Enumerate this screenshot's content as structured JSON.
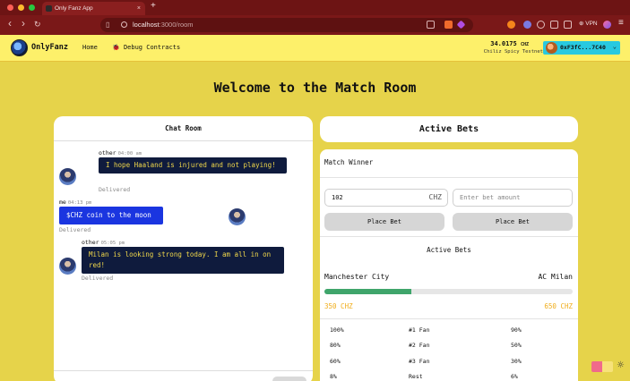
{
  "browser": {
    "tab_title": "Only Fanz App",
    "tab_close": "×",
    "new_tab": "+",
    "url_host": "localhost",
    "url_path": ":3000/room",
    "vpn_label": "VPN",
    "nav": {
      "back": "‹",
      "forward": "›",
      "reload": "↻"
    },
    "icons": [
      "bookmark-icon",
      "lock-icon",
      "share-icon",
      "brave-shield-icon",
      "extensions-icon",
      "menu-icon"
    ]
  },
  "app": {
    "brand": "OnlyFanz",
    "nav_links": {
      "home": "Home",
      "debug": "Debug Contracts"
    },
    "debug_icon": "🐞",
    "balance_value": "34.0175",
    "balance_unit": "CHZ",
    "network": "Chiliz Spicy Testnet",
    "wallet_address": "0xF3fC...7C40",
    "wallet_chevron": "⌄",
    "accent": "#28c9e0"
  },
  "page": {
    "title": "Welcome to the Match Room"
  },
  "chat": {
    "title": "Chat Room",
    "messages": [
      {
        "sender": "other",
        "time": "04:00 am",
        "text": "I hope Haaland is injured and not playing!",
        "status": "Delivered"
      },
      {
        "sender": "me",
        "time": "04:13 pm",
        "text": "$CHZ coin to the moon",
        "status": "Delivered"
      },
      {
        "sender": "other",
        "time": "05:05 pm",
        "text": "Milan is looking strong today. I am all in on red!",
        "status": "Delivered"
      }
    ]
  },
  "bets": {
    "header": "Active Bets",
    "market": "Match Winner",
    "input_left_value": "102",
    "input_left_unit": "CHZ",
    "input_right_placeholder": "Enter bet amount",
    "place_bet_label": "Place Bet",
    "subheader": "Active Bets",
    "team_home": "Manchester City",
    "team_away": "AC Milan",
    "home_share": 0.35,
    "amount_home": "350 CHZ",
    "amount_away": "650 CHZ",
    "amount_color": "#f0ad1a",
    "bar_color": "#3fa56b",
    "table": [
      [
        "100%",
        "#1 Fan",
        "90%"
      ],
      [
        "80%",
        "#2 Fan",
        "50%"
      ],
      [
        "60%",
        "#3 Fan",
        "30%"
      ],
      [
        "8%",
        "Rest",
        "6%"
      ]
    ]
  }
}
